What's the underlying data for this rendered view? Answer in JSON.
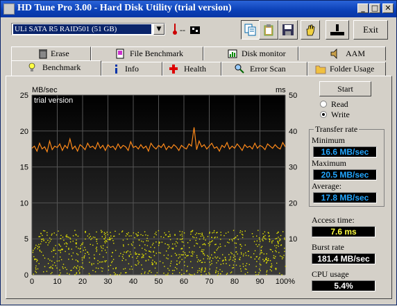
{
  "window": {
    "title": "HD Tune Pro 3.00 - Hard Disk Utility (trial version)",
    "caption_buttons": {
      "minimize": "_",
      "maximize": "□",
      "close": "✕"
    }
  },
  "toolbar": {
    "drive_selected": "ULi SATA R5    RAID501 (51 GB)",
    "temperature_text": "--",
    "exit_label": "Exit",
    "icons": [
      "copy-icon",
      "clipboard-icon",
      "save-icon",
      "hand-icon",
      "drive-icon"
    ]
  },
  "tabs_top": [
    {
      "label": "Erase",
      "icon": "trash-icon"
    },
    {
      "label": "File Benchmark",
      "icon": "file-benchmark-icon"
    },
    {
      "label": "Disk monitor",
      "icon": "disk-monitor-icon"
    },
    {
      "label": "AAM",
      "icon": "speaker-icon"
    }
  ],
  "tabs_bottom": [
    {
      "label": "Benchmark",
      "icon": "lightbulb-icon",
      "active": true
    },
    {
      "label": "Info",
      "icon": "info-icon"
    },
    {
      "label": "Health",
      "icon": "health-cross-icon"
    },
    {
      "label": "Error Scan",
      "icon": "magnifier-icon"
    },
    {
      "label": "Folder Usage",
      "icon": "folder-icon"
    }
  ],
  "benchmark": {
    "start_label": "Start",
    "read_label": "Read",
    "write_label": "Write",
    "mode_selected": "Write",
    "transfer_rate_label": "Transfer rate",
    "minimum_label": "Minimum",
    "minimum_value": "16.6 MB/sec",
    "maximum_label": "Maximum",
    "maximum_value": "20.5 MB/sec",
    "average_label": "Average:",
    "average_value": "17.8 MB/sec",
    "access_time_label": "Access time:",
    "access_time_value": "7.6 ms",
    "burst_rate_label": "Burst rate",
    "burst_rate_value": "181.4 MB/sec",
    "cpu_usage_label": "CPU usage",
    "cpu_usage_value": "5.4%"
  },
  "chart_data": {
    "type": "line",
    "watermark": "trial version",
    "y_left_unit": "MB/sec",
    "y_right_unit": "ms",
    "y_left_ticks": [
      "25",
      "20",
      "15",
      "10",
      "5",
      "0"
    ],
    "y_right_ticks": [
      "50",
      "40",
      "30",
      "20",
      "10",
      ""
    ],
    "x_ticks": [
      "0",
      "10",
      "20",
      "30",
      "40",
      "50",
      "60",
      "70",
      "80",
      "90",
      "100%"
    ],
    "ylim_left": [
      0,
      25
    ],
    "ylim_right": [
      0,
      50
    ],
    "xlim": [
      0,
      100
    ],
    "colors": {
      "line": "#ff8a1a",
      "scatter": "#e8e800",
      "background_top": "#000000",
      "background_bottom": "#3a3a3a",
      "grid": "#555555"
    },
    "series": [
      {
        "kind": "line",
        "axis": "left",
        "x": [
          0,
          1,
          2,
          3,
          4,
          5,
          6,
          7,
          8,
          9,
          10,
          11,
          12,
          13,
          14,
          15,
          16,
          17,
          18,
          19,
          20,
          21,
          22,
          23,
          24,
          25,
          26,
          27,
          28,
          29,
          30,
          31,
          32,
          33,
          34,
          35,
          36,
          37,
          38,
          39,
          40,
          41,
          42,
          43,
          44,
          45,
          46,
          47,
          48,
          49,
          50,
          51,
          52,
          53,
          54,
          55,
          56,
          57,
          58,
          59,
          60,
          61,
          62,
          63,
          64,
          65,
          66,
          67,
          68,
          69,
          70,
          71,
          72,
          73,
          74,
          75,
          76,
          77,
          78,
          79,
          80,
          81,
          82,
          83,
          84,
          85,
          86,
          87,
          88,
          89,
          90,
          91,
          92,
          93,
          94,
          95,
          96,
          97,
          98,
          99,
          100
        ],
        "values": [
          17.6,
          17.9,
          17.2,
          18.3,
          17.5,
          17.8,
          17.1,
          18.6,
          17.4,
          17.9,
          17.7,
          18.2,
          17.3,
          18.0,
          17.6,
          18.9,
          17.5,
          17.9,
          17.2,
          18.1,
          17.8,
          17.4,
          18.3,
          17.7,
          17.9,
          17.5,
          18.4,
          17.6,
          18.0,
          17.3,
          18.1,
          17.7,
          17.9,
          17.4,
          18.2,
          17.6,
          18.0,
          17.8,
          17.3,
          18.5,
          17.7,
          17.9,
          17.5,
          18.1,
          17.6,
          17.9,
          17.2,
          18.3,
          17.8,
          17.5,
          18.0,
          17.7,
          18.2,
          17.4,
          17.9,
          17.6,
          18.1,
          17.8,
          17.3,
          18.0,
          17.7,
          17.5,
          18.2,
          17.9,
          20.5,
          17.4,
          18.6,
          17.8,
          18.1,
          17.5,
          17.9,
          18.3,
          17.6,
          17.8,
          17.2,
          18.0,
          17.7,
          18.4,
          17.5,
          17.9,
          17.6,
          18.2,
          17.8,
          17.3,
          18.1,
          17.7,
          17.9,
          17.5,
          18.3,
          17.6,
          18.0,
          17.8,
          17.4,
          18.2,
          17.9,
          17.6,
          18.1,
          17.7,
          17.5,
          18.4,
          17.8
        ]
      },
      {
        "kind": "scatter",
        "axis": "right",
        "description_range_ms": [
          0,
          12.5
        ],
        "count": 900
      }
    ]
  }
}
